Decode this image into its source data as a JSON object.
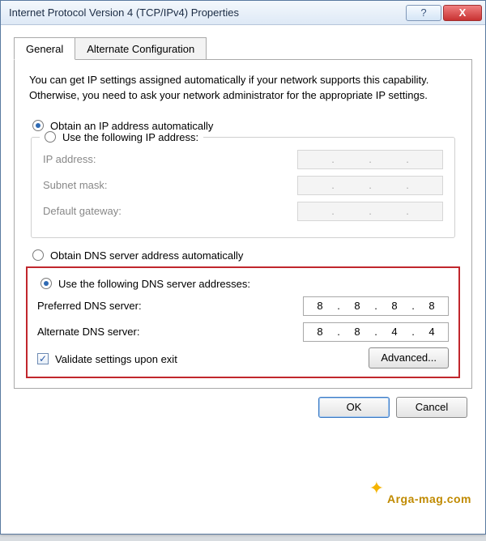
{
  "window": {
    "title": "Internet Protocol Version 4 (TCP/IPv4) Properties"
  },
  "tabs": {
    "general": "General",
    "alternate": "Alternate Configuration"
  },
  "description": "You can get IP settings assigned automatically if your network supports this capability. Otherwise, you need to ask your network administrator for the appropriate IP settings.",
  "radios": {
    "obtain_ip": "Obtain an IP address automatically",
    "use_ip": "Use the following IP address:",
    "obtain_dns": "Obtain DNS server address automatically",
    "use_dns": "Use the following DNS server addresses:"
  },
  "labels": {
    "ip_address": "IP address:",
    "subnet_mask": "Subnet mask:",
    "default_gateway": "Default gateway:",
    "preferred_dns": "Preferred DNS server:",
    "alternate_dns": "Alternate DNS server:",
    "validate": "Validate settings upon exit"
  },
  "values": {
    "ip_address": [
      "",
      "",
      "",
      ""
    ],
    "subnet_mask": [
      "",
      "",
      "",
      ""
    ],
    "default_gateway": [
      "",
      "",
      "",
      ""
    ],
    "preferred_dns": [
      "8",
      "8",
      "8",
      "8"
    ],
    "alternate_dns": [
      "8",
      "8",
      "4",
      "4"
    ]
  },
  "buttons": {
    "advanced": "Advanced...",
    "ok": "OK",
    "cancel": "Cancel",
    "help": "?",
    "close": "X"
  },
  "state": {
    "ip_mode": "auto",
    "dns_mode": "manual",
    "validate_checked": true
  },
  "watermark": "Arga-mag.com"
}
